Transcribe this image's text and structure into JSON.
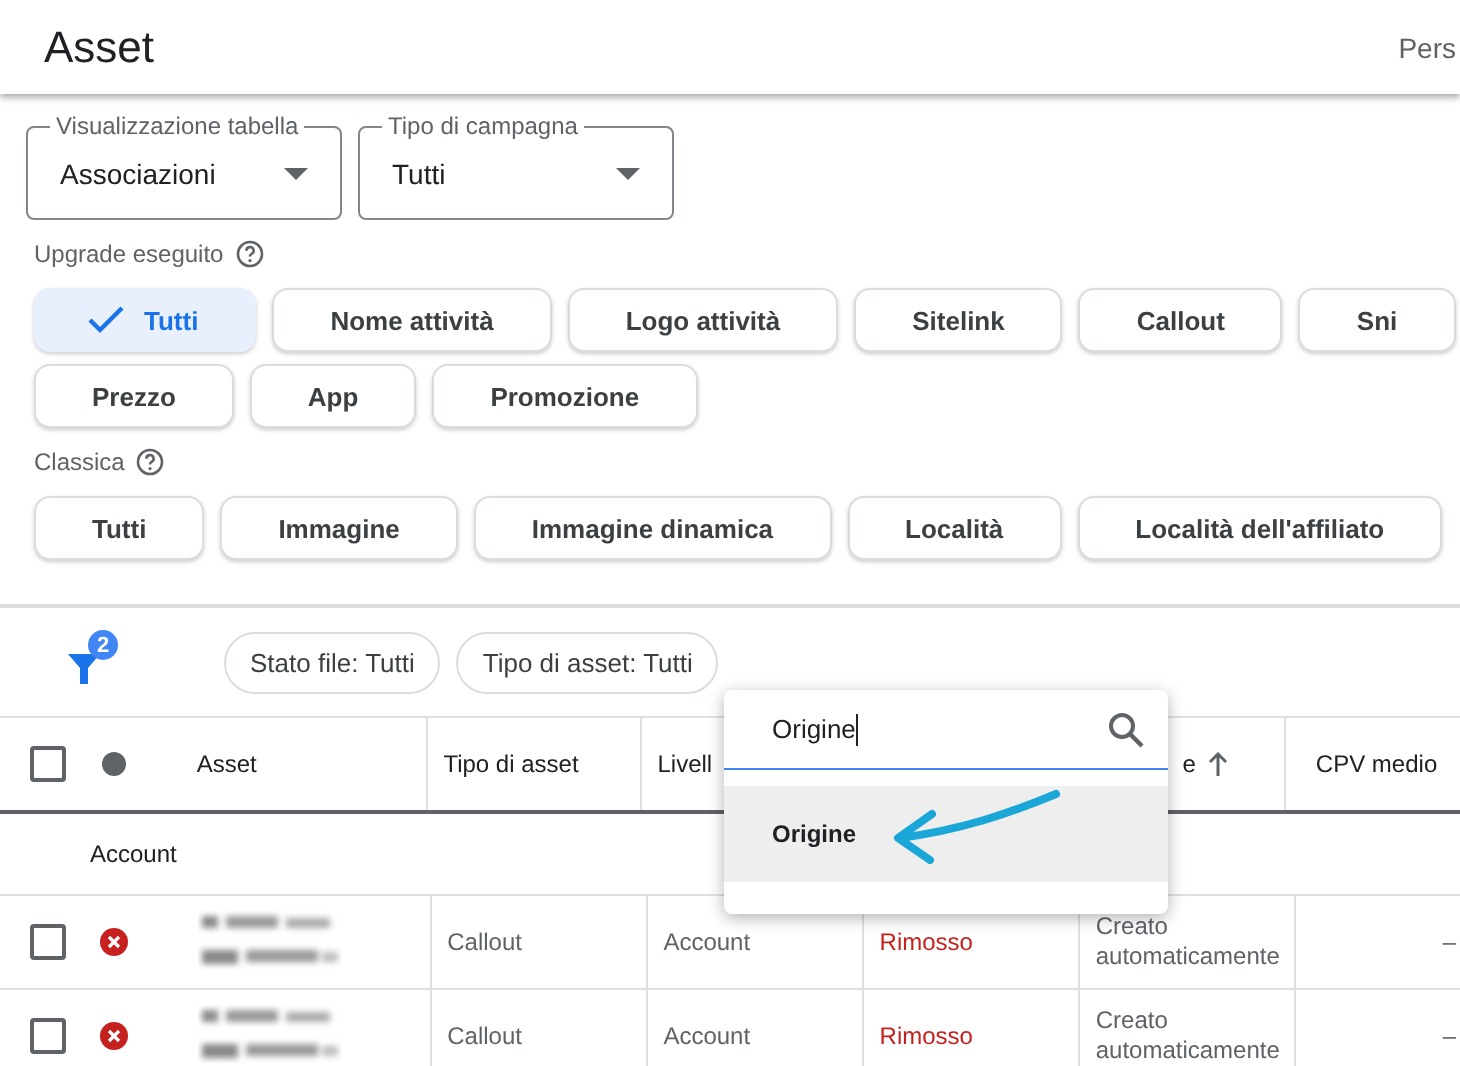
{
  "header": {
    "title": "Asset",
    "right_text": "Pers"
  },
  "selects": [
    {
      "label": "Visualizzazione tabella",
      "value": "Associazioni"
    },
    {
      "label": "Tipo di campagna",
      "value": "Tutti"
    }
  ],
  "chip_groups": [
    {
      "label": "Upgrade eseguito",
      "rows": [
        [
          {
            "label": "Tutti",
            "selected": true
          },
          {
            "label": "Nome attività",
            "selected": false
          },
          {
            "label": "Logo attività",
            "selected": false
          },
          {
            "label": "Sitelink",
            "selected": false
          },
          {
            "label": "Callout",
            "selected": false
          },
          {
            "label": "Sni",
            "selected": false
          }
        ],
        [
          {
            "label": "Prezzo",
            "selected": false
          },
          {
            "label": "App",
            "selected": false
          },
          {
            "label": "Promozione",
            "selected": false
          }
        ]
      ]
    },
    {
      "label": "Classica",
      "rows": [
        [
          {
            "label": "Tutti",
            "selected": false
          },
          {
            "label": "Immagine",
            "selected": false
          },
          {
            "label": "Immagine dinamica",
            "selected": false
          },
          {
            "label": "Località",
            "selected": false
          },
          {
            "label": "Località dell'affiliato",
            "selected": false
          }
        ]
      ]
    }
  ],
  "filter_bar": {
    "badge": "2",
    "filters": [
      "Stato file: Tutti",
      "Tipo di asset: Tutti"
    ]
  },
  "table": {
    "all_checked": false,
    "columns": [
      {
        "label": "Asset",
        "sorted": false
      },
      {
        "label": "Tipo di asset",
        "sorted": false
      },
      {
        "label": "Livell",
        "sorted": false
      },
      {
        "label": "e",
        "sorted": true
      },
      {
        "label": "CPV medio",
        "sorted": false
      }
    ],
    "group": "Account",
    "rows": [
      {
        "checked": false,
        "removed": true,
        "type": "Callout",
        "level": "Account",
        "state": "Rimosso",
        "source": "Creato automaticamente",
        "cpv": "–"
      },
      {
        "checked": false,
        "removed": true,
        "type": "Callout",
        "level": "Account",
        "state": "Rimosso",
        "source": "Creato automaticamente",
        "cpv": "–"
      }
    ]
  },
  "dropdown": {
    "query": "Origine",
    "options": [
      {
        "label": "Origine",
        "selected": true
      }
    ]
  }
}
